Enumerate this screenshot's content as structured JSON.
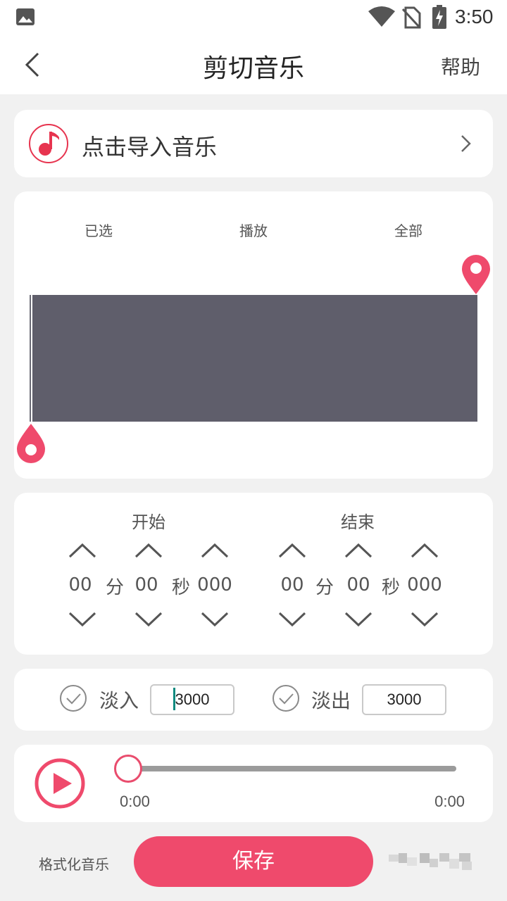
{
  "status_bar": {
    "time": "3:50"
  },
  "header": {
    "title": "剪切音乐",
    "help_label": "帮助"
  },
  "import": {
    "label": "点击导入音乐"
  },
  "waveform": {
    "tabs": [
      "已选",
      "播放",
      "全部"
    ]
  },
  "time_range": {
    "start": {
      "label": "开始",
      "minutes": "00",
      "minutes_unit": "分",
      "seconds": "00",
      "seconds_unit": "秒",
      "millis": "000"
    },
    "end": {
      "label": "结束",
      "minutes": "00",
      "minutes_unit": "分",
      "seconds": "00",
      "seconds_unit": "秒",
      "millis": "000"
    }
  },
  "fade": {
    "fade_in": {
      "label": "淡入",
      "value": "3000"
    },
    "fade_out": {
      "label": "淡出",
      "value": "3000"
    }
  },
  "player": {
    "current_time": "0:00",
    "total_time": "0:00",
    "progress": 0
  },
  "bottom": {
    "format_label": "格式化音乐",
    "save_label": "保存"
  },
  "colors": {
    "accent": "#ef4a6c",
    "waveform": "#5f5e6b"
  }
}
